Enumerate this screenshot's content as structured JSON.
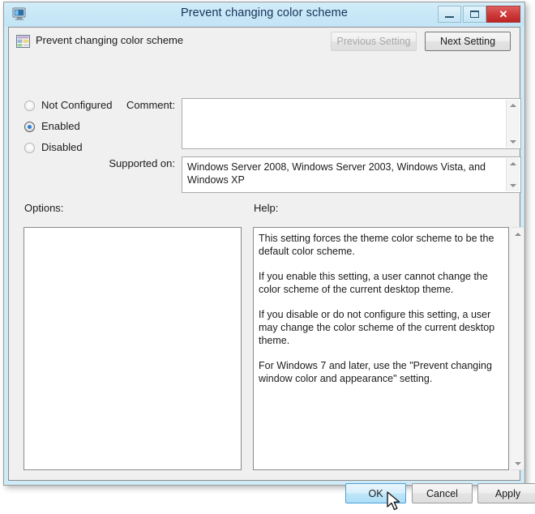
{
  "window": {
    "title": "Prevent changing color scheme",
    "title_icon": "monitor-icon",
    "minimize_label": "–",
    "maximize_label": "",
    "close_label": "✕"
  },
  "header": {
    "policy_icon": "policy-setting-icon",
    "policy_name": "Prevent changing color scheme",
    "previous_setting_label": "Previous Setting",
    "next_setting_label": "Next Setting",
    "previous_enabled": false,
    "next_enabled": true
  },
  "state_options": {
    "selected": "Enabled",
    "items": [
      {
        "label": "Not Configured",
        "checked": false
      },
      {
        "label": "Enabled",
        "checked": true
      },
      {
        "label": "Disabled",
        "checked": false
      }
    ]
  },
  "comment": {
    "label": "Comment:",
    "value": ""
  },
  "supported_on": {
    "label": "Supported on:",
    "value": "Windows Server 2008, Windows Server 2003, Windows Vista, and Windows XP"
  },
  "options": {
    "label": "Options:",
    "value": ""
  },
  "help": {
    "label": "Help:",
    "paragraphs": [
      "This setting forces the theme color scheme to be the default color scheme.",
      "If you enable this setting, a user cannot change the color scheme of the current desktop theme.",
      "If you disable or do not configure this setting, a user may change the color scheme of the current desktop theme.",
      "For Windows 7 and later, use the \"Prevent changing window color and appearance\" setting."
    ]
  },
  "footer": {
    "ok_label": "OK",
    "cancel_label": "Cancel",
    "apply_label": "Apply",
    "ok_hovered": true
  },
  "colors": {
    "titlebar": "#c9e8f7",
    "title_text": "#14325a",
    "close_button": "#cf3c3c",
    "dialog_bg": "#f0f0f0",
    "radio_dot": "#2b7fd6",
    "ok_highlight": "#bfe5f8"
  }
}
